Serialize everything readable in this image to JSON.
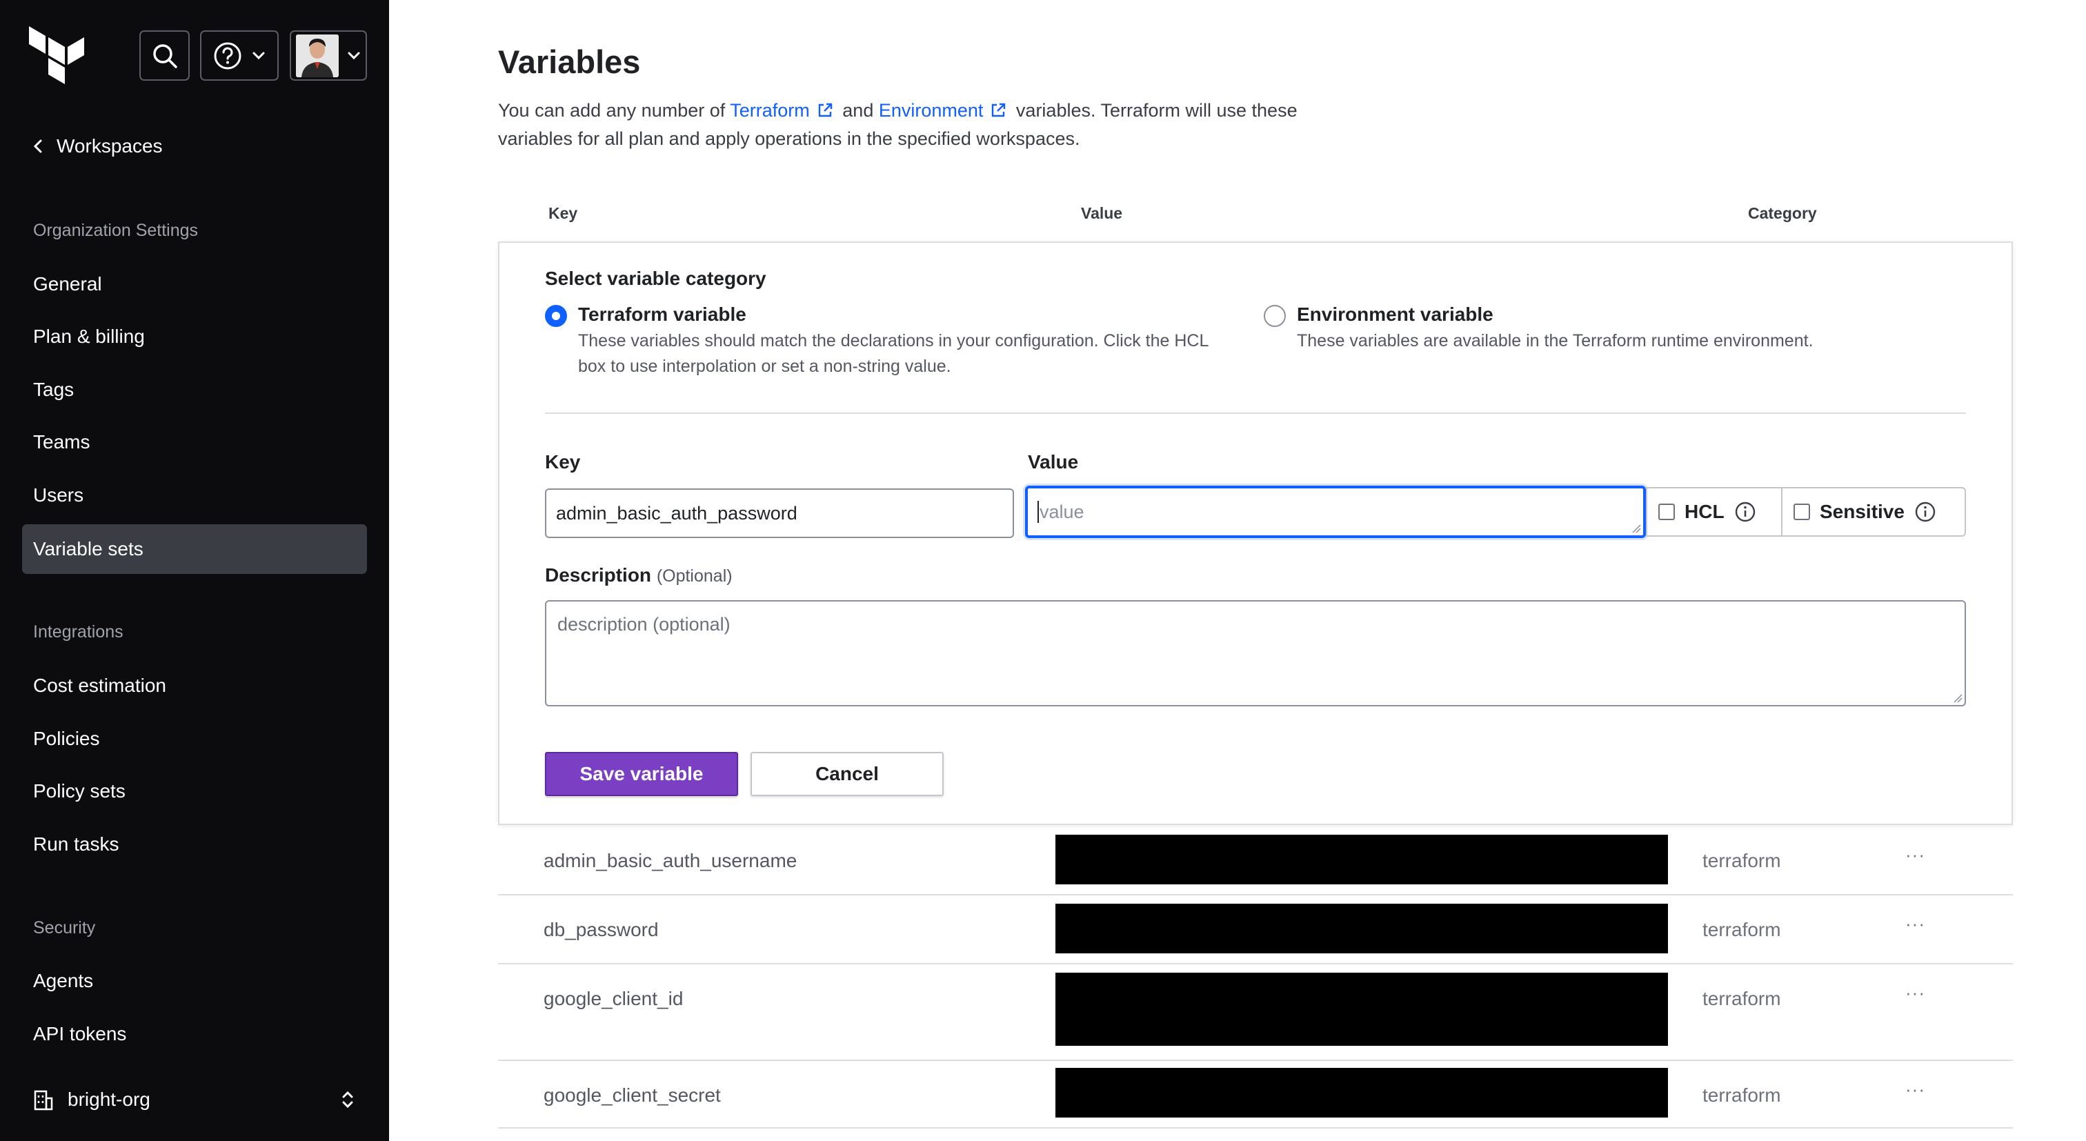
{
  "colors": {
    "sidebar_bg": "#0c0c0e",
    "active_nav_bg": "#3b3d45",
    "link": "#1060ff",
    "primary_button": "#7b3fc4",
    "focus_ring": "#1060ff"
  },
  "sidebar": {
    "logo_icon": "terraform-logo-icon",
    "back_link": "Workspaces",
    "sections": [
      {
        "heading": "Organization Settings",
        "items": [
          {
            "label": "General",
            "active": false
          },
          {
            "label": "Plan & billing",
            "active": false
          },
          {
            "label": "Tags",
            "active": false
          },
          {
            "label": "Teams",
            "active": false
          },
          {
            "label": "Users",
            "active": false
          },
          {
            "label": "Variable sets",
            "active": true
          }
        ]
      },
      {
        "heading": "Integrations",
        "items": [
          {
            "label": "Cost estimation"
          },
          {
            "label": "Policies"
          },
          {
            "label": "Policy sets"
          },
          {
            "label": "Run tasks"
          }
        ]
      },
      {
        "heading": "Security",
        "items": [
          {
            "label": "Agents"
          },
          {
            "label": "API tokens"
          }
        ]
      }
    ],
    "org_switcher": "bright-org"
  },
  "main": {
    "title": "Variables",
    "intro": {
      "before": "You can add any number of ",
      "link1": "Terraform",
      "middle": " and ",
      "link2": "Environment",
      "after": " variables. Terraform will use these variables for all plan and apply operations in the specified workspaces."
    },
    "columns": {
      "key": "Key",
      "value": "Value",
      "category": "Category"
    },
    "form": {
      "category_title": "Select variable category",
      "options": [
        {
          "label": "Terraform variable",
          "description": "These variables should match the declarations in your configuration. Click the HCL box to use interpolation or set a non-string value.",
          "selected": true
        },
        {
          "label": "Environment variable",
          "description": "These variables are available in the Terraform runtime environment.",
          "selected": false
        }
      ],
      "key_label": "Key",
      "key_value": "admin_basic_auth_password",
      "value_label": "Value",
      "value_placeholder": "value",
      "hcl_label": "HCL",
      "sensitive_label": "Sensitive",
      "description_label": "Description",
      "description_optional": "(Optional)",
      "description_placeholder": "description (optional)",
      "save_label": "Save variable",
      "cancel_label": "Cancel"
    },
    "variables": [
      {
        "key": "admin_basic_auth_username",
        "category": "terraform",
        "menu": "···"
      },
      {
        "key": "db_password",
        "category": "terraform",
        "menu": "···"
      },
      {
        "key": "google_client_id",
        "category": "terraform",
        "menu": "···"
      },
      {
        "key": "google_client_secret",
        "category": "terraform",
        "menu": "···"
      }
    ]
  }
}
